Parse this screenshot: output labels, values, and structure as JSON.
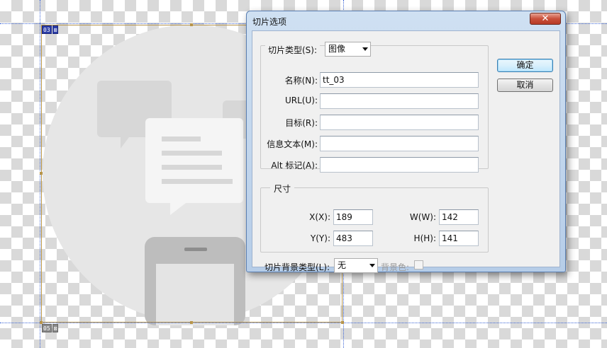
{
  "dialog": {
    "title": "切片选项",
    "close_glyph": "✕",
    "slice_type_label": "切片类型(S):",
    "slice_type_value": "图像",
    "fields": [
      {
        "label": "名称(N):",
        "value": "tt_03"
      },
      {
        "label": "URL(U):",
        "value": ""
      },
      {
        "label": "目标(R):",
        "value": ""
      },
      {
        "label": "信息文本(M):",
        "value": ""
      },
      {
        "label": "Alt 标记(A):",
        "value": ""
      }
    ],
    "dimensions": {
      "legend": "尺寸",
      "x_label": "X(X):",
      "x_value": "189",
      "y_label": "Y(Y):",
      "y_value": "483",
      "w_label": "W(W):",
      "w_value": "142",
      "h_label": "H(H):",
      "h_value": "141"
    },
    "bg_type_label": "切片背景类型(L):",
    "bg_type_value": "无",
    "bg_color_label": "背景色:",
    "ok_label": "确定",
    "cancel_label": "取消"
  },
  "slice_badges": {
    "top": [
      "03",
      "⊠"
    ],
    "bottom": [
      "05",
      "⊠"
    ]
  },
  "colors": {
    "guide": "#3a63d6",
    "slice_border": "#b8954a",
    "art_gray": "#e6e6e6",
    "art_mid": "#d4d4d4"
  },
  "icons": [
    "close-icon",
    "chevron-down-icon",
    "chat-bubble-icon",
    "phone-icon"
  ]
}
